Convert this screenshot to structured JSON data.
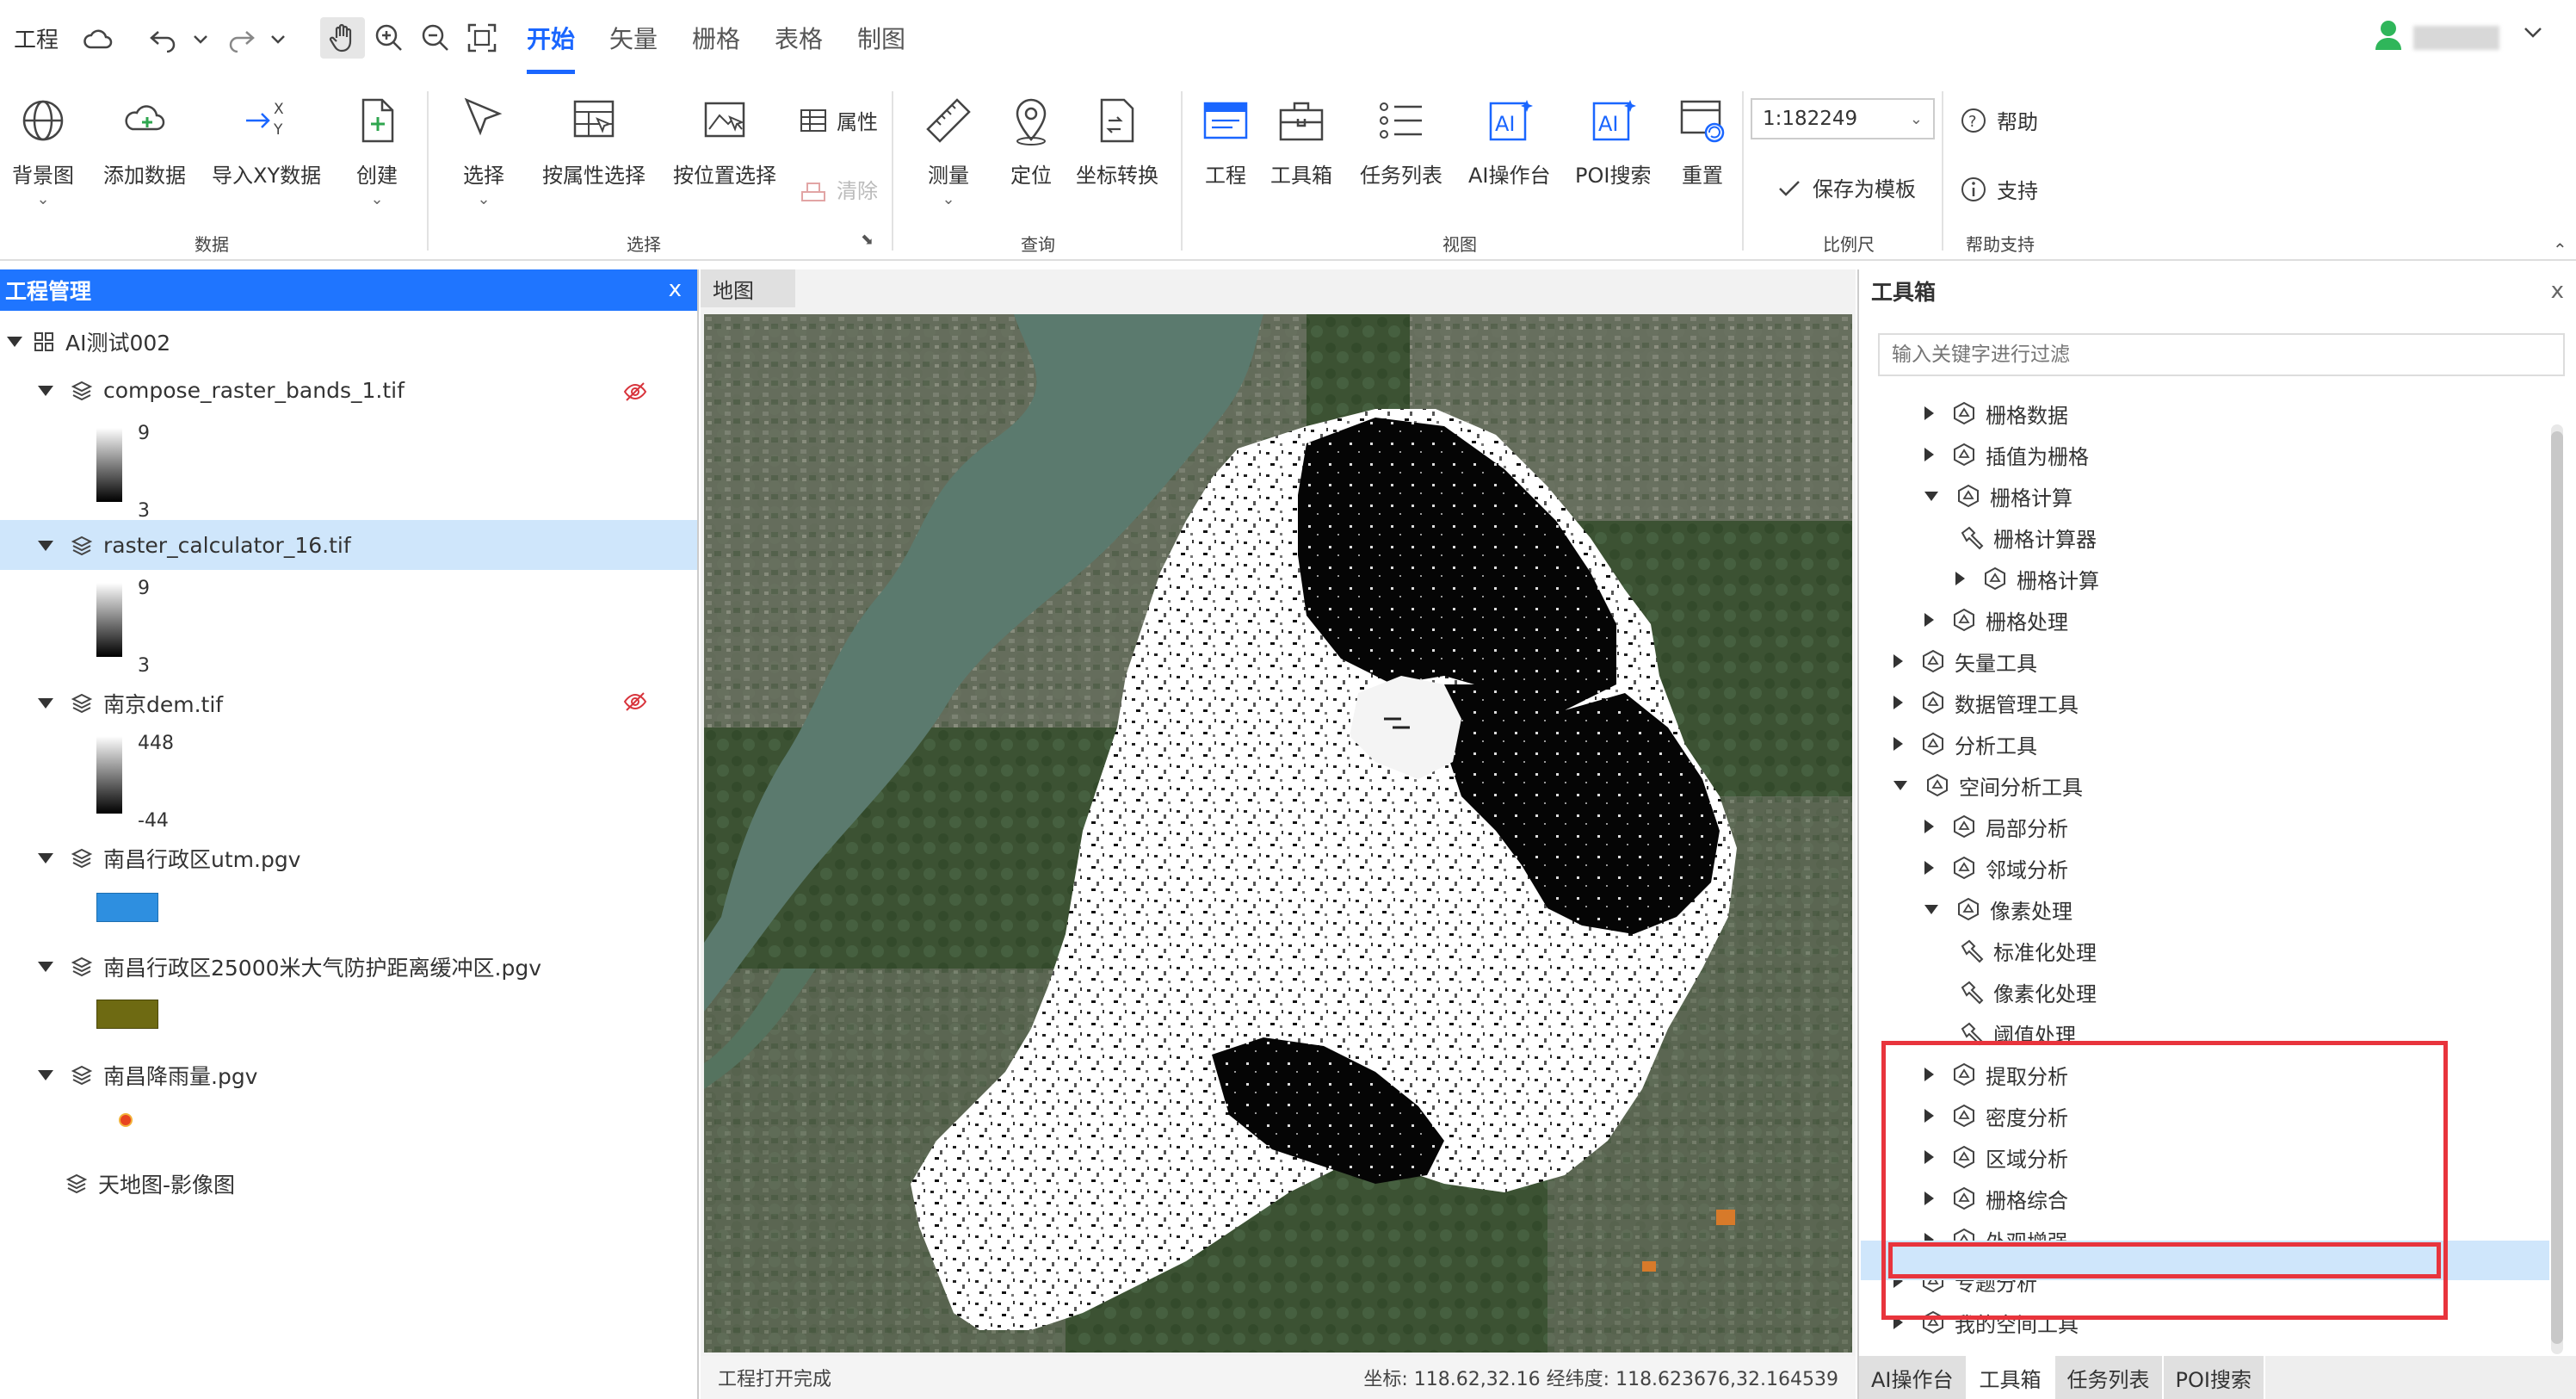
{
  "menubar": {
    "project": "工程",
    "tabs": [
      "开始",
      "矢量",
      "栅格",
      "表格",
      "制图"
    ],
    "active_tab": "开始"
  },
  "ribbon": {
    "groups": {
      "data": "数据",
      "select": "选择",
      "query": "查询",
      "view": "视图",
      "scale": "比例尺",
      "help": "帮助支持"
    },
    "basemap": "背景图",
    "add_data": "添加数据",
    "import_xy": "导入XY数据",
    "create": "创建",
    "select": "选择",
    "select_by_attr": "按属性选择",
    "select_by_loc": "按位置选择",
    "attribute": "属性",
    "clear": "清除",
    "measure": "测量",
    "locate": "定位",
    "coord_convert": "坐标转换",
    "project": "工程",
    "toolbox": "工具箱",
    "tasklist": "任务列表",
    "ai_workbench": "AI操作台",
    "poi_search": "POI搜索",
    "reset": "重置",
    "scale_value": "1:182249",
    "save_template": "保存为模板",
    "help": "帮助",
    "support": "支持"
  },
  "left_panel": {
    "title": "工程管理",
    "close": "x",
    "project_name": "AI测试002",
    "layers": [
      {
        "name": "compose_raster_bands_1.tif",
        "max": "9",
        "min": "3"
      },
      {
        "name": "raster_calculator_16.tif",
        "max": "9",
        "min": "3"
      },
      {
        "name": "南京dem.tif",
        "max": "448",
        "min": "-44"
      },
      {
        "name": "南昌行政区utm.pgv",
        "color": "#2e8fe0"
      },
      {
        "name": "南昌行政区25000米大气防护距离缓冲区.pgv",
        "color": "#6e6a12"
      },
      {
        "name": "南昌降雨量.pgv",
        "color": "#e84420"
      },
      {
        "name": "天地图-影像图"
      }
    ]
  },
  "map": {
    "tab": "地图",
    "status": "工程打开完成",
    "coords": "坐标: 118.62,32.16 经纬度: 118.623676,32.164539"
  },
  "toolbox": {
    "title": "工具箱",
    "close": "x",
    "search_placeholder": "输入关键字进行过滤",
    "items": [
      "栅格数据",
      "插值为栅格",
      "栅格计算",
      "栅格计算器",
      "栅格计算",
      "栅格处理",
      "矢量工具",
      "数据管理工具",
      "分析工具",
      "空间分析工具",
      "局部分析",
      "邻域分析",
      "像素处理",
      "标准化处理",
      "像素化处理",
      "阈值处理",
      "提取分析",
      "密度分析",
      "区域分析",
      "栅格综合",
      "外观增强",
      "专题分析",
      "我的空间工具"
    ],
    "bottom_tabs": [
      "AI操作台",
      "工具箱",
      "任务列表",
      "POI搜索"
    ]
  }
}
